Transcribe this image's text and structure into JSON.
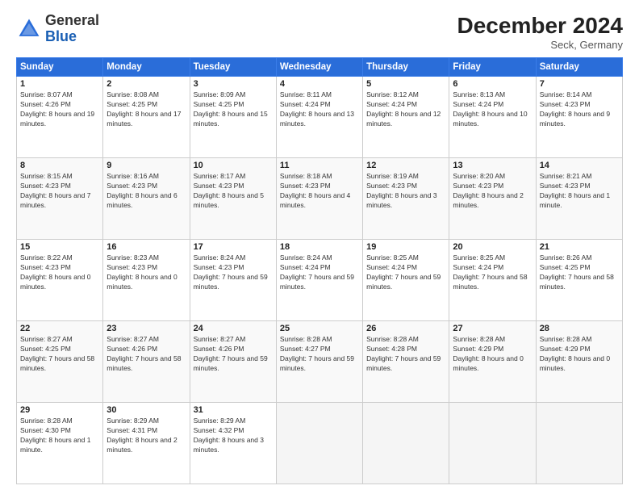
{
  "header": {
    "logo_general": "General",
    "logo_blue": "Blue",
    "month_title": "December 2024",
    "subtitle": "Seck, Germany"
  },
  "days_of_week": [
    "Sunday",
    "Monday",
    "Tuesday",
    "Wednesday",
    "Thursday",
    "Friday",
    "Saturday"
  ],
  "weeks": [
    [
      {
        "day": "1",
        "sunrise": "8:07 AM",
        "sunset": "4:26 PM",
        "daylight": "8 hours and 19 minutes."
      },
      {
        "day": "2",
        "sunrise": "8:08 AM",
        "sunset": "4:25 PM",
        "daylight": "8 hours and 17 minutes."
      },
      {
        "day": "3",
        "sunrise": "8:09 AM",
        "sunset": "4:25 PM",
        "daylight": "8 hours and 15 minutes."
      },
      {
        "day": "4",
        "sunrise": "8:11 AM",
        "sunset": "4:24 PM",
        "daylight": "8 hours and 13 minutes."
      },
      {
        "day": "5",
        "sunrise": "8:12 AM",
        "sunset": "4:24 PM",
        "daylight": "8 hours and 12 minutes."
      },
      {
        "day": "6",
        "sunrise": "8:13 AM",
        "sunset": "4:24 PM",
        "daylight": "8 hours and 10 minutes."
      },
      {
        "day": "7",
        "sunrise": "8:14 AM",
        "sunset": "4:23 PM",
        "daylight": "8 hours and 9 minutes."
      }
    ],
    [
      {
        "day": "8",
        "sunrise": "8:15 AM",
        "sunset": "4:23 PM",
        "daylight": "8 hours and 7 minutes."
      },
      {
        "day": "9",
        "sunrise": "8:16 AM",
        "sunset": "4:23 PM",
        "daylight": "8 hours and 6 minutes."
      },
      {
        "day": "10",
        "sunrise": "8:17 AM",
        "sunset": "4:23 PM",
        "daylight": "8 hours and 5 minutes."
      },
      {
        "day": "11",
        "sunrise": "8:18 AM",
        "sunset": "4:23 PM",
        "daylight": "8 hours and 4 minutes."
      },
      {
        "day": "12",
        "sunrise": "8:19 AM",
        "sunset": "4:23 PM",
        "daylight": "8 hours and 3 minutes."
      },
      {
        "day": "13",
        "sunrise": "8:20 AM",
        "sunset": "4:23 PM",
        "daylight": "8 hours and 2 minutes."
      },
      {
        "day": "14",
        "sunrise": "8:21 AM",
        "sunset": "4:23 PM",
        "daylight": "8 hours and 1 minute."
      }
    ],
    [
      {
        "day": "15",
        "sunrise": "8:22 AM",
        "sunset": "4:23 PM",
        "daylight": "8 hours and 0 minutes."
      },
      {
        "day": "16",
        "sunrise": "8:23 AM",
        "sunset": "4:23 PM",
        "daylight": "8 hours and 0 minutes."
      },
      {
        "day": "17",
        "sunrise": "8:24 AM",
        "sunset": "4:23 PM",
        "daylight": "7 hours and 59 minutes."
      },
      {
        "day": "18",
        "sunrise": "8:24 AM",
        "sunset": "4:24 PM",
        "daylight": "7 hours and 59 minutes."
      },
      {
        "day": "19",
        "sunrise": "8:25 AM",
        "sunset": "4:24 PM",
        "daylight": "7 hours and 59 minutes."
      },
      {
        "day": "20",
        "sunrise": "8:25 AM",
        "sunset": "4:24 PM",
        "daylight": "7 hours and 58 minutes."
      },
      {
        "day": "21",
        "sunrise": "8:26 AM",
        "sunset": "4:25 PM",
        "daylight": "7 hours and 58 minutes."
      }
    ],
    [
      {
        "day": "22",
        "sunrise": "8:27 AM",
        "sunset": "4:25 PM",
        "daylight": "7 hours and 58 minutes."
      },
      {
        "day": "23",
        "sunrise": "8:27 AM",
        "sunset": "4:26 PM",
        "daylight": "7 hours and 58 minutes."
      },
      {
        "day": "24",
        "sunrise": "8:27 AM",
        "sunset": "4:26 PM",
        "daylight": "7 hours and 59 minutes."
      },
      {
        "day": "25",
        "sunrise": "8:28 AM",
        "sunset": "4:27 PM",
        "daylight": "7 hours and 59 minutes."
      },
      {
        "day": "26",
        "sunrise": "8:28 AM",
        "sunset": "4:28 PM",
        "daylight": "7 hours and 59 minutes."
      },
      {
        "day": "27",
        "sunrise": "8:28 AM",
        "sunset": "4:29 PM",
        "daylight": "8 hours and 0 minutes."
      },
      {
        "day": "28",
        "sunrise": "8:28 AM",
        "sunset": "4:29 PM",
        "daylight": "8 hours and 0 minutes."
      }
    ],
    [
      {
        "day": "29",
        "sunrise": "8:28 AM",
        "sunset": "4:30 PM",
        "daylight": "8 hours and 1 minute."
      },
      {
        "day": "30",
        "sunrise": "8:29 AM",
        "sunset": "4:31 PM",
        "daylight": "8 hours and 2 minutes."
      },
      {
        "day": "31",
        "sunrise": "8:29 AM",
        "sunset": "4:32 PM",
        "daylight": "8 hours and 3 minutes."
      },
      null,
      null,
      null,
      null
    ]
  ]
}
